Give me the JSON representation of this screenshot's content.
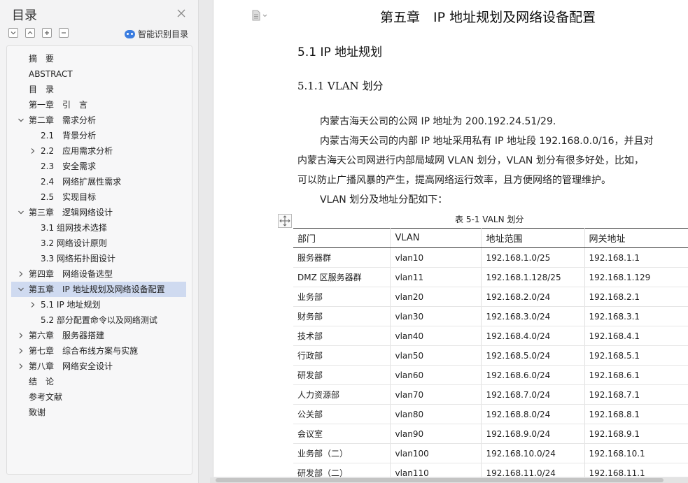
{
  "sidebar": {
    "title": "目录",
    "smart_label": "智能识别目录",
    "items": [
      {
        "label": "摘　要",
        "level": 0,
        "arrow": "none"
      },
      {
        "label": "ABSTRACT",
        "level": 0,
        "arrow": "none"
      },
      {
        "label": "目　录",
        "level": 0,
        "arrow": "none"
      },
      {
        "label": "第一章　引　言",
        "level": 0,
        "arrow": "none"
      },
      {
        "label": "第二章　需求分析",
        "level": 0,
        "arrow": "down"
      },
      {
        "label": "2.1　背景分析",
        "level": 1,
        "arrow": "none"
      },
      {
        "label": "2.2　应用需求分析",
        "level": 1,
        "arrow": "right"
      },
      {
        "label": "2.3　安全需求",
        "level": 1,
        "arrow": "none"
      },
      {
        "label": "2.4　网络扩展性需求",
        "level": 1,
        "arrow": "none"
      },
      {
        "label": "2.5　实现目标",
        "level": 1,
        "arrow": "none"
      },
      {
        "label": "第三章　逻辑网络设计",
        "level": 0,
        "arrow": "down"
      },
      {
        "label": "3.1 组网技术选择",
        "level": 1,
        "arrow": "none"
      },
      {
        "label": "3.2 网络设计原则",
        "level": 1,
        "arrow": "none"
      },
      {
        "label": "3.3 网络拓扑图设计",
        "level": 1,
        "arrow": "none"
      },
      {
        "label": "第四章　网络设备选型",
        "level": 0,
        "arrow": "right"
      },
      {
        "label": "第五章　IP 地址规划及网络设备配置",
        "level": 0,
        "arrow": "down",
        "active": true
      },
      {
        "label": "5.1 IP 地址规划",
        "level": 1,
        "arrow": "right"
      },
      {
        "label": "5.2  部分配置命令以及网络测试",
        "level": 1,
        "arrow": "none"
      },
      {
        "label": "第六章　服务器搭建",
        "level": 0,
        "arrow": "right"
      },
      {
        "label": "第七章　综合布线方案与实施",
        "level": 0,
        "arrow": "right"
      },
      {
        "label": "第八章　网络安全设计",
        "level": 0,
        "arrow": "right"
      },
      {
        "label": "结　论",
        "level": 0,
        "arrow": "none"
      },
      {
        "label": "参考文献",
        "level": 0,
        "arrow": "none"
      },
      {
        "label": "致谢",
        "level": 0,
        "arrow": "none"
      }
    ]
  },
  "doc": {
    "chapter_title": "第五章　IP 地址规划及网络设备配置",
    "section_title": "5.1 IP 地址规划",
    "subsection_title": "5.1.1 VLAN 划分",
    "paragraphs": [
      "内蒙古海天公司的公网 IP 地址为 200.192.24.51/29.",
      "内蒙古海天公司的内部 IP 地址采用私有 IP 地址段 192.168.0.0/16，并且对",
      "内蒙古海天公司网进行内部局域网 VLAN 划分，VLAN 划分有很多好处，比如，",
      "可以防止广播风暴的产生，提高网络运行效率，且方便网络的管理维护。",
      "VLAN 划分及地址分配如下："
    ],
    "table_caption": "表 5-1 VALN 划分",
    "table_headers": [
      "部门",
      "VLAN",
      "地址范围",
      "网关地址"
    ],
    "table_rows": [
      [
        "服务器群",
        "vlan10",
        "192.168.1.0/25",
        "192.168.1.1"
      ],
      [
        "DMZ 区服务器群",
        "vlan11",
        "192.168.1.128/25",
        "192.168.1.129"
      ],
      [
        "业务部",
        "vlan20",
        "192.168.2.0/24",
        "192.168.2.1"
      ],
      [
        "财务部",
        "vlan30",
        "192.168.3.0/24",
        "192.168.3.1"
      ],
      [
        "技术部",
        "vlan40",
        "192.168.4.0/24",
        "192.168.4.1"
      ],
      [
        "行政部",
        "vlan50",
        "192.168.5.0/24",
        "192.168.5.1"
      ],
      [
        "研发部",
        "vlan60",
        "192.168.6.0/24",
        "192.168.6.1"
      ],
      [
        "人力资源部",
        "vlan70",
        "192.168.7.0/24",
        "192.168.7.1"
      ],
      [
        "公关部",
        "vlan80",
        "192.168.8.0/24",
        "192.168.8.1"
      ],
      [
        "会议室",
        "vlan90",
        "192.168.9.0/24",
        "192.168.9.1"
      ],
      [
        "业务部（二）",
        "vlan100",
        "192.168.10.0/24",
        "192.168.10.1"
      ],
      [
        "研发部（二）",
        "vlan110",
        "192.168.11.0/24",
        "192.168.11.1"
      ]
    ]
  },
  "icons": {
    "close": "close-icon",
    "collapse_all": "collapse-all-icon",
    "expand_all": "expand-all-icon",
    "add": "add-heading-icon",
    "remove": "remove-heading-icon",
    "smart": "smart-recognize-icon",
    "document": "document-icon",
    "move": "table-move-icon"
  },
  "colors": {
    "accent": "#3b7de0",
    "active_row": "#cfdaf0"
  }
}
